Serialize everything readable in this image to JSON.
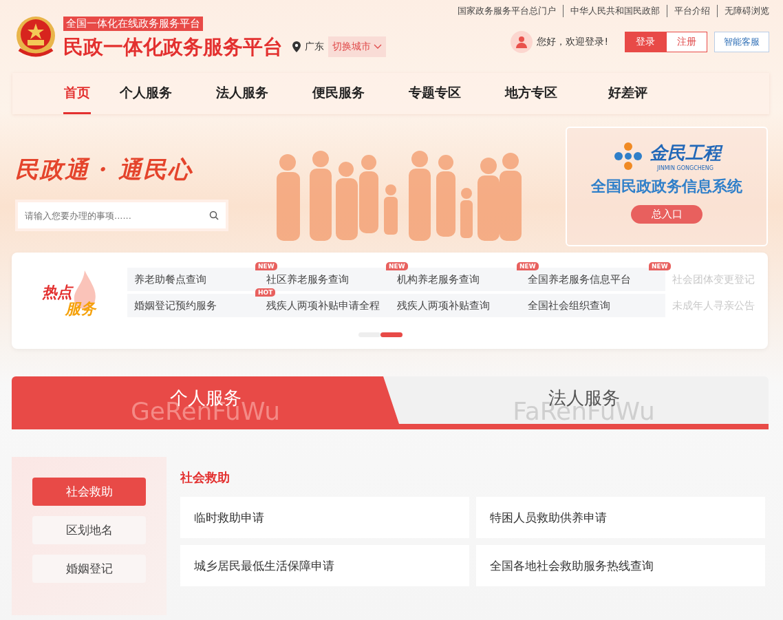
{
  "top_links": [
    "国家政务服务平台总门户",
    "中华人民共和国民政部",
    "平台介绍",
    "无障碍浏览"
  ],
  "brand": {
    "tag": "全国一体化在线政务服务平台",
    "title": "民政一体化政务服务平台"
  },
  "location": {
    "province": "广东",
    "switch": "切换城市"
  },
  "user": {
    "greeting": "您好，欢迎登录!",
    "login": "登录",
    "register": "注册",
    "service": "智能客服"
  },
  "nav": [
    {
      "label": "首页",
      "selected": true
    },
    {
      "label": "个人服务",
      "selected": false
    },
    {
      "label": "法人服务",
      "selected": false
    },
    {
      "label": "便民服务",
      "selected": false
    },
    {
      "label": "专题专区",
      "selected": false
    },
    {
      "label": "地方专区",
      "selected": false
    },
    {
      "label": "好差评",
      "selected": false
    }
  ],
  "banner": {
    "slogan": "民政通 · 通民心",
    "search": {
      "placeholder": "请输入您要办理的事项......"
    },
    "system": {
      "logo_text": "金民工程",
      "logo_sub": "JINMIN GONGCHENG",
      "title": "全国民政政务信息系统",
      "entry": "总入口"
    }
  },
  "hot": {
    "title_1": "热点",
    "title_2": "服务",
    "items": [
      {
        "label": "养老助餐点查询",
        "faded": false
      },
      {
        "label": "社区养老服务查询",
        "faded": false,
        "badge": "NEW"
      },
      {
        "label": "机构养老服务查询",
        "faded": false,
        "badge": "NEW"
      },
      {
        "label": "全国养老服务信息平台",
        "faded": false,
        "badge": "NEW"
      },
      {
        "label": "社会团体变更登记",
        "faded": true,
        "badge": "NEW"
      },
      {
        "label": "婚姻登记预约服务",
        "faded": false
      },
      {
        "label": "残疾人两项补贴申请全程",
        "faded": false,
        "badge": "HOT"
      },
      {
        "label": "残疾人两项补贴查询",
        "faded": false
      },
      {
        "label": "全国社会组织查询",
        "faded": false
      },
      {
        "label": "未成年人寻亲公告",
        "faded": true
      }
    ],
    "pages": [
      {
        "selected": false
      },
      {
        "selected": true
      }
    ]
  },
  "service_tabs": [
    {
      "label": "个人服务",
      "pinyin": "GeRenFuWu",
      "selected": true
    },
    {
      "label": "法人服务",
      "pinyin": "FaRenFuWu",
      "selected": false
    }
  ],
  "categories": [
    {
      "label": "社会救助",
      "selected": true
    },
    {
      "label": "区划地名",
      "selected": false
    },
    {
      "label": "婚姻登记",
      "selected": false
    }
  ],
  "section": {
    "title": "社会救助",
    "items": [
      "临时救助申请",
      "特困人员救助供养申请",
      "城乡居民最低生活保障申请",
      "全国各地社会救助服务热线查询"
    ]
  }
}
